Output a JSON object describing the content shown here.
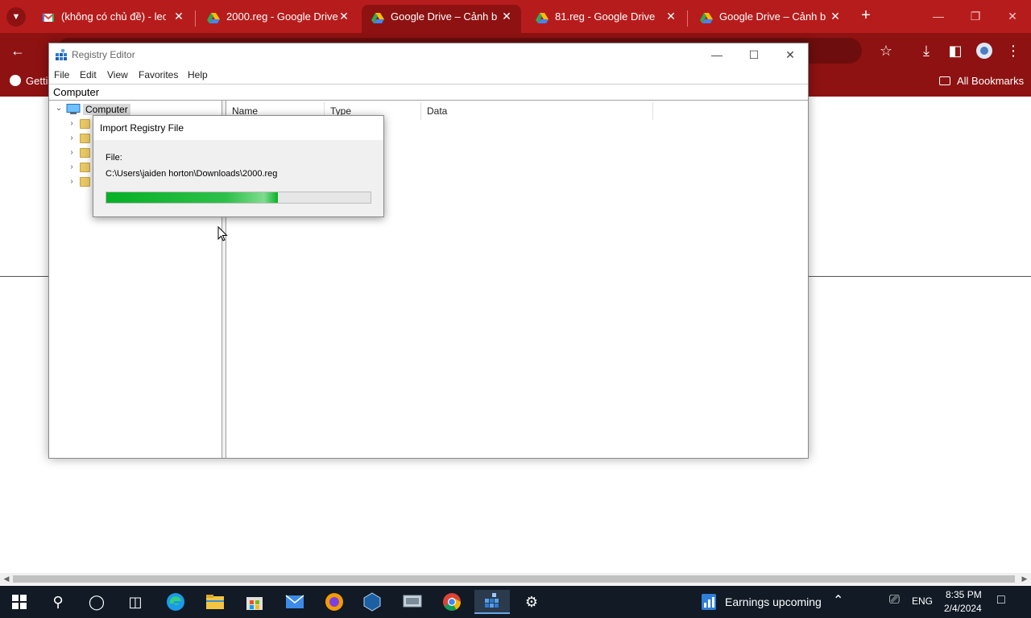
{
  "browser": {
    "tabs": [
      {
        "title": "(không có chủ đề) - leco",
        "favicon": "gmail-icon",
        "active": false
      },
      {
        "title": "2000.reg - Google Drive",
        "favicon": "google-drive-icon",
        "active": false
      },
      {
        "title": "Google Drive – Cảnh báo",
        "favicon": "google-drive-icon",
        "active": true
      },
      {
        "title": "81.reg - Google Drive",
        "favicon": "google-drive-icon",
        "active": false
      },
      {
        "title": "Google Drive – Cảnh báo",
        "favicon": "google-drive-icon",
        "active": false
      }
    ],
    "bookmarks": {
      "first_partial": "Getti",
      "all_bookmarks": "All Bookmarks"
    },
    "colors": {
      "frame": "#b71c1c",
      "toolbar": "#8e1212"
    }
  },
  "regedit": {
    "title": "Registry Editor",
    "menu": [
      "File",
      "Edit",
      "View",
      "Favorites",
      "Help"
    ],
    "address": "Computer",
    "tree_root": "Computer",
    "columns": [
      "Name",
      "Type",
      "Data"
    ]
  },
  "import_dialog": {
    "title": "Import Registry File",
    "file_label": "File:",
    "file_path": "C:\\Users\\jaiden horton\\Downloads\\2000.reg",
    "progress": 0.65
  },
  "taskbar": {
    "weather": "Earnings upcoming",
    "language": "ENG",
    "time": "8:35 PM",
    "date": "2/4/2024"
  }
}
